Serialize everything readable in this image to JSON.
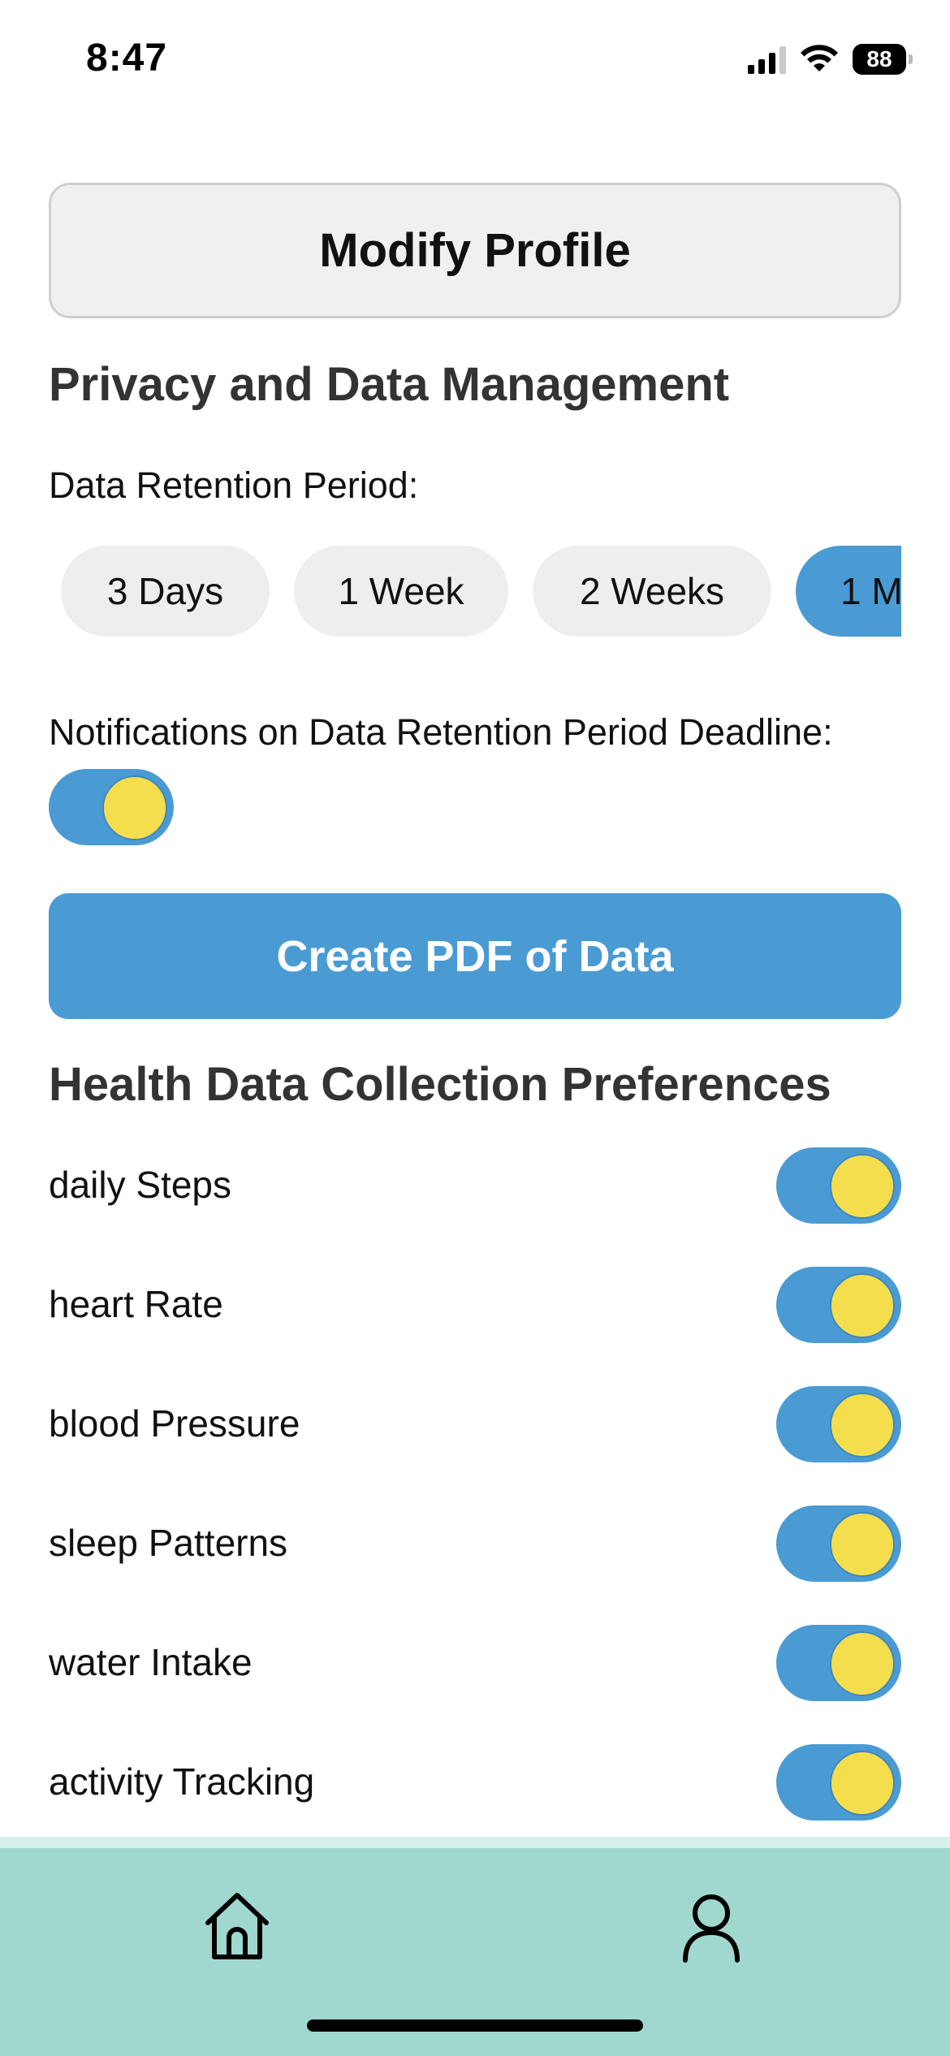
{
  "status_bar": {
    "time": "8:47",
    "battery": "88"
  },
  "profile": {
    "modify_label": "Modify Profile"
  },
  "privacy": {
    "title": "Privacy and Data Management",
    "retention_label": "Data Retention Period:",
    "retention_options": [
      "3 Days",
      "1 Week",
      "2 Weeks",
      "1 M"
    ],
    "selected_option": "1 M",
    "notifications_label": "Notifications on Data Retention Period Deadline:",
    "notifications_enabled": true
  },
  "actions": {
    "create_pdf_label": "Create PDF of Data"
  },
  "health": {
    "title": "Health Data Collection Preferences",
    "preferences": [
      {
        "label": "daily Steps",
        "enabled": true
      },
      {
        "label": "heart Rate",
        "enabled": true
      },
      {
        "label": "blood Pressure",
        "enabled": true
      },
      {
        "label": "sleep Patterns",
        "enabled": true
      },
      {
        "label": "water Intake",
        "enabled": true
      },
      {
        "label": "activity Tracking",
        "enabled": true
      }
    ]
  },
  "nav": {
    "items": [
      "home-icon",
      "profile-icon"
    ]
  },
  "colors": {
    "accent": "#4a9bd4",
    "toggle_knob": "#f5de4d",
    "nav_background": "#a0d8cf",
    "button_background": "#f0f0f0"
  }
}
